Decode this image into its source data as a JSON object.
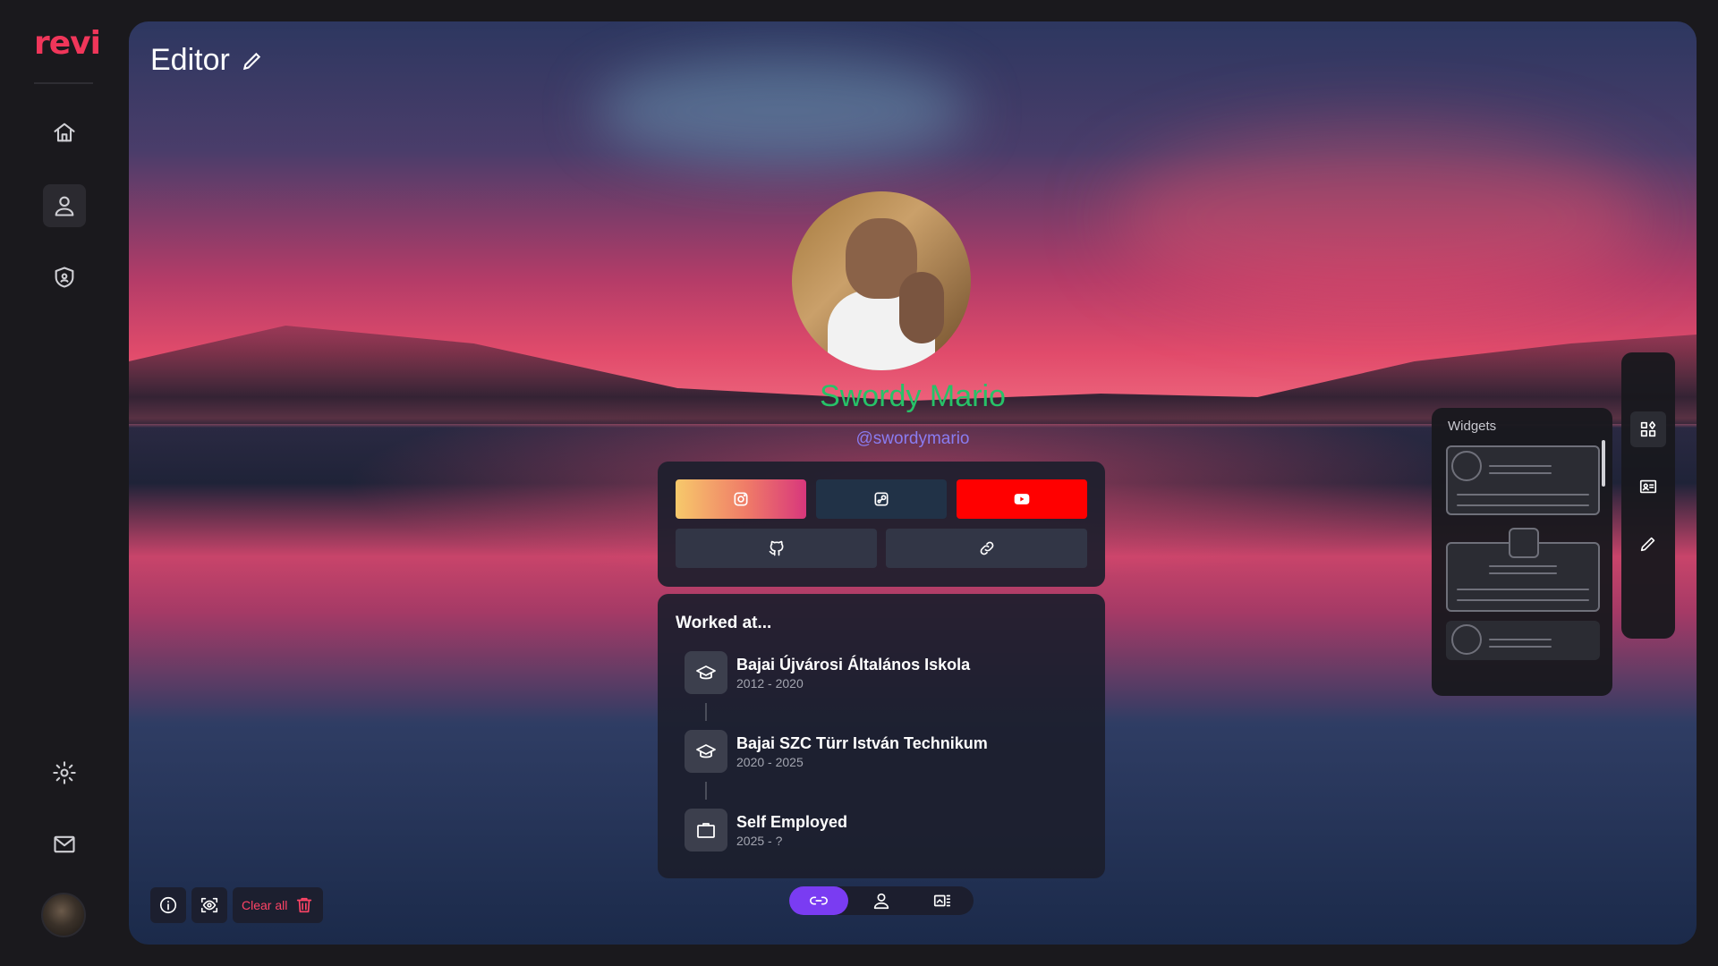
{
  "app": {
    "logo": "revi"
  },
  "sidebar": {
    "items": [
      {
        "icon": "home-icon"
      },
      {
        "icon": "user-icon",
        "active": true
      },
      {
        "icon": "shield-icon"
      }
    ],
    "bottom": [
      {
        "icon": "gear-icon"
      },
      {
        "icon": "mail-icon"
      }
    ]
  },
  "editor": {
    "title": "Editor"
  },
  "profile": {
    "name": "Swordy Mario",
    "handle": "@swordymario",
    "name_color": "#27c268",
    "handle_color": "#8a7cf0"
  },
  "links": [
    {
      "platform": "instagram",
      "icon": "instagram-icon"
    },
    {
      "platform": "steam",
      "icon": "steam-icon"
    },
    {
      "platform": "youtube",
      "icon": "youtube-icon",
      "color": "#ff0000"
    },
    {
      "platform": "github",
      "icon": "github-icon"
    },
    {
      "platform": "link",
      "icon": "link-icon"
    }
  ],
  "worked": {
    "title": "Worked at...",
    "items": [
      {
        "name": "Bajai Újvárosi Általános Iskola",
        "years": "2012 - 2020",
        "icon": "graduation-cap-icon"
      },
      {
        "name": "Bajai SZC Türr István Technikum",
        "years": "2020 - 2025",
        "icon": "graduation-cap-icon"
      },
      {
        "name": "Self Employed",
        "years": "2025 - ?",
        "icon": "briefcase-icon"
      }
    ]
  },
  "toolbar": {
    "clear_label": "Clear all"
  },
  "widgets": {
    "label": "Widgets"
  },
  "colors": {
    "accent": "#7a3cf2",
    "danger": "#ff4466",
    "brand": "#f0365a"
  }
}
